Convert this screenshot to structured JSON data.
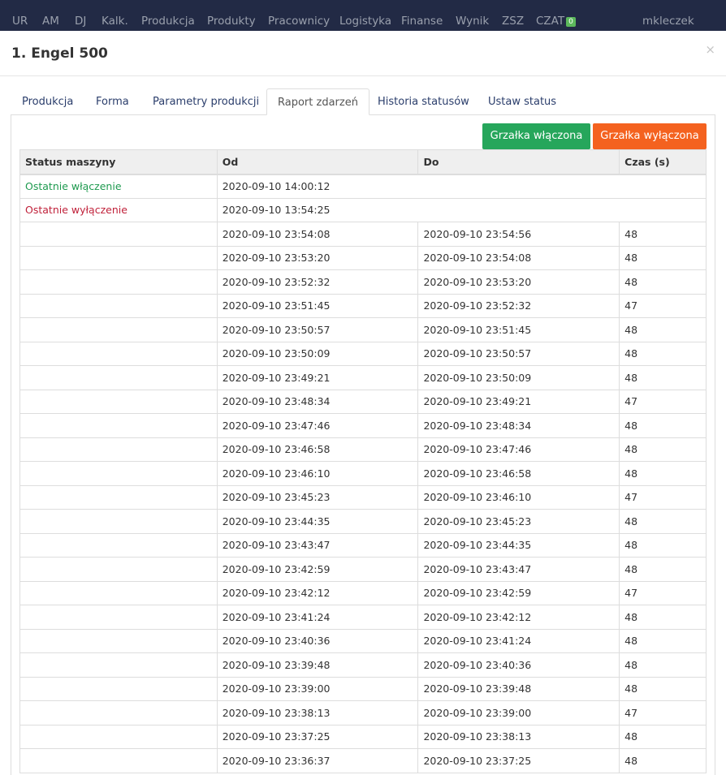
{
  "nav": {
    "items": [
      "UR",
      "AM",
      "DJ",
      "Kalk.",
      "Produkcja",
      "Produkty",
      "Pracownicy",
      "Logistyka",
      "Finanse",
      "Wynik",
      "ZSZ",
      "CZAT"
    ],
    "chat_badge": "0",
    "user": "mkleczek"
  },
  "modal": {
    "title": "1. Engel 500",
    "close": "×"
  },
  "tabs": [
    "Produkcja",
    "Forma",
    "Parametry produkcji",
    "Raport zdarzeń",
    "Historia statusów",
    "Ustaw status"
  ],
  "active_tab": "Raport zdarzeń",
  "buttons": {
    "on": "Grzałka włączona",
    "off": "Grzałka wyłączona"
  },
  "table": {
    "headers": [
      "Status maszyny",
      "Od",
      "Do",
      "Czas (s)"
    ],
    "summary": [
      {
        "status": "Ostatnie włączenie",
        "od": "2020-09-10 14:00:12",
        "type": "on"
      },
      {
        "status": "Ostatnie wyłączenie",
        "od": "2020-09-10 13:54:25",
        "type": "off"
      }
    ],
    "rows": [
      [
        "2020-09-10 23:54:08",
        "2020-09-10 23:54:56",
        "48"
      ],
      [
        "2020-09-10 23:53:20",
        "2020-09-10 23:54:08",
        "48"
      ],
      [
        "2020-09-10 23:52:32",
        "2020-09-10 23:53:20",
        "48"
      ],
      [
        "2020-09-10 23:51:45",
        "2020-09-10 23:52:32",
        "47"
      ],
      [
        "2020-09-10 23:50:57",
        "2020-09-10 23:51:45",
        "48"
      ],
      [
        "2020-09-10 23:50:09",
        "2020-09-10 23:50:57",
        "48"
      ],
      [
        "2020-09-10 23:49:21",
        "2020-09-10 23:50:09",
        "48"
      ],
      [
        "2020-09-10 23:48:34",
        "2020-09-10 23:49:21",
        "47"
      ],
      [
        "2020-09-10 23:47:46",
        "2020-09-10 23:48:34",
        "48"
      ],
      [
        "2020-09-10 23:46:58",
        "2020-09-10 23:47:46",
        "48"
      ],
      [
        "2020-09-10 23:46:10",
        "2020-09-10 23:46:58",
        "48"
      ],
      [
        "2020-09-10 23:45:23",
        "2020-09-10 23:46:10",
        "47"
      ],
      [
        "2020-09-10 23:44:35",
        "2020-09-10 23:45:23",
        "48"
      ],
      [
        "2020-09-10 23:43:47",
        "2020-09-10 23:44:35",
        "48"
      ],
      [
        "2020-09-10 23:42:59",
        "2020-09-10 23:43:47",
        "48"
      ],
      [
        "2020-09-10 23:42:12",
        "2020-09-10 23:42:59",
        "47"
      ],
      [
        "2020-09-10 23:41:24",
        "2020-09-10 23:42:12",
        "48"
      ],
      [
        "2020-09-10 23:40:36",
        "2020-09-10 23:41:24",
        "48"
      ],
      [
        "2020-09-10 23:39:48",
        "2020-09-10 23:40:36",
        "48"
      ],
      [
        "2020-09-10 23:39:00",
        "2020-09-10 23:39:48",
        "48"
      ],
      [
        "2020-09-10 23:38:13",
        "2020-09-10 23:39:00",
        "47"
      ],
      [
        "2020-09-10 23:37:25",
        "2020-09-10 23:38:13",
        "48"
      ],
      [
        "2020-09-10 23:36:37",
        "2020-09-10 23:37:25",
        "48"
      ]
    ]
  },
  "colors": {
    "nav_bg": "#222a45",
    "on_green": "#26a65b",
    "off_orange": "#f4621f",
    "status_on_text": "#1e9a4f",
    "status_off_text": "#c0213a"
  }
}
